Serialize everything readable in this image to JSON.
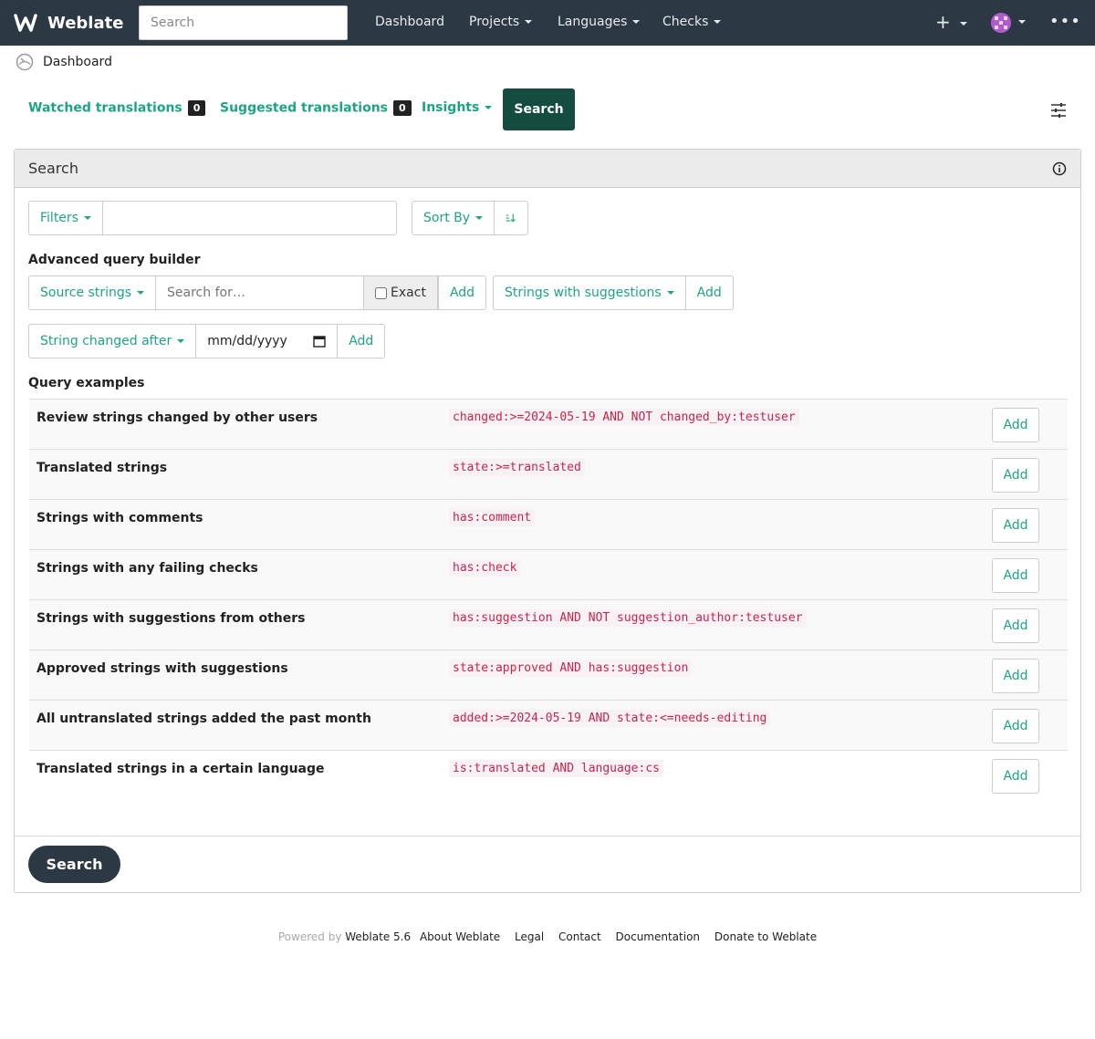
{
  "navbar": {
    "brand": "Weblate",
    "search_placeholder": "Search",
    "links": [
      "Dashboard",
      "Projects",
      "Languages",
      "Checks"
    ],
    "plus_label": "+",
    "more_label": "•••"
  },
  "breadcrumb": {
    "label": "Dashboard"
  },
  "tabs": {
    "watched": {
      "label": "Watched translations",
      "count": "0"
    },
    "suggested": {
      "label": "Suggested translations",
      "count": "0"
    },
    "insights": {
      "label": "Insights"
    },
    "search": {
      "label": "Search"
    }
  },
  "panel": {
    "title": "Search",
    "filters_label": "Filters",
    "sort_label": "Sort By",
    "advanced_heading": "Advanced query builder",
    "source_strings_label": "Source strings",
    "search_for_placeholder": "Search for…",
    "exact_label": "Exact",
    "add_label": "Add",
    "suggestions_label": "Strings with suggestions",
    "changed_after_label": "String changed after",
    "date_placeholder": "mm/dd/yyyy",
    "examples_heading": "Query examples",
    "examples": [
      {
        "label": "Review strings changed by other users",
        "query": "changed:>=2024-05-19 AND NOT changed_by:testuser"
      },
      {
        "label": "Translated strings",
        "query": "state:>=translated"
      },
      {
        "label": "Strings with comments",
        "query": "has:comment"
      },
      {
        "label": "Strings with any failing checks",
        "query": "has:check"
      },
      {
        "label": "Strings with suggestions from others",
        "query": "has:suggestion AND NOT suggestion_author:testuser"
      },
      {
        "label": "Approved strings with suggestions",
        "query": "state:approved AND has:suggestion"
      },
      {
        "label": "All untranslated strings added the past month",
        "query": "added:>=2024-05-19 AND state:<=needs-editing"
      },
      {
        "label": "Translated strings in a certain language",
        "query": "is:translated AND language:cs"
      }
    ],
    "submit_label": "Search"
  },
  "footer": {
    "powered_by": "Powered by",
    "version": "Weblate 5.6",
    "links": [
      "About Weblate",
      "Legal",
      "Contact",
      "Documentation",
      "Donate to Weblate"
    ]
  },
  "colors": {
    "navbar": "#2c3844",
    "accent": "#1fa385",
    "active_tab": "#144d3f",
    "code": "#c7254e"
  }
}
